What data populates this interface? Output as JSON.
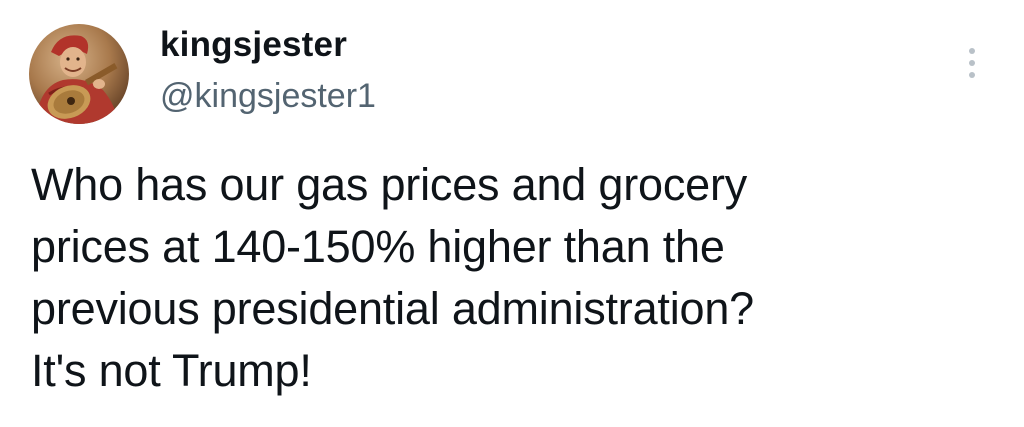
{
  "author": {
    "display_name": "kingsjester",
    "handle": "@kingsjester1",
    "avatar_icon": "jester-lute-portrait-avatar"
  },
  "menu": {
    "more_icon": "more-options-vertical-icon"
  },
  "tweet": {
    "text": "Who has our gas prices and grocery\nprices at 140-150% higher than the\nprevious presidential administration?\nIt's not Trump!"
  },
  "colors": {
    "text_primary": "#0f1419",
    "text_secondary": "#536471",
    "menu_dots": "#b9c1c8",
    "background": "#ffffff"
  }
}
